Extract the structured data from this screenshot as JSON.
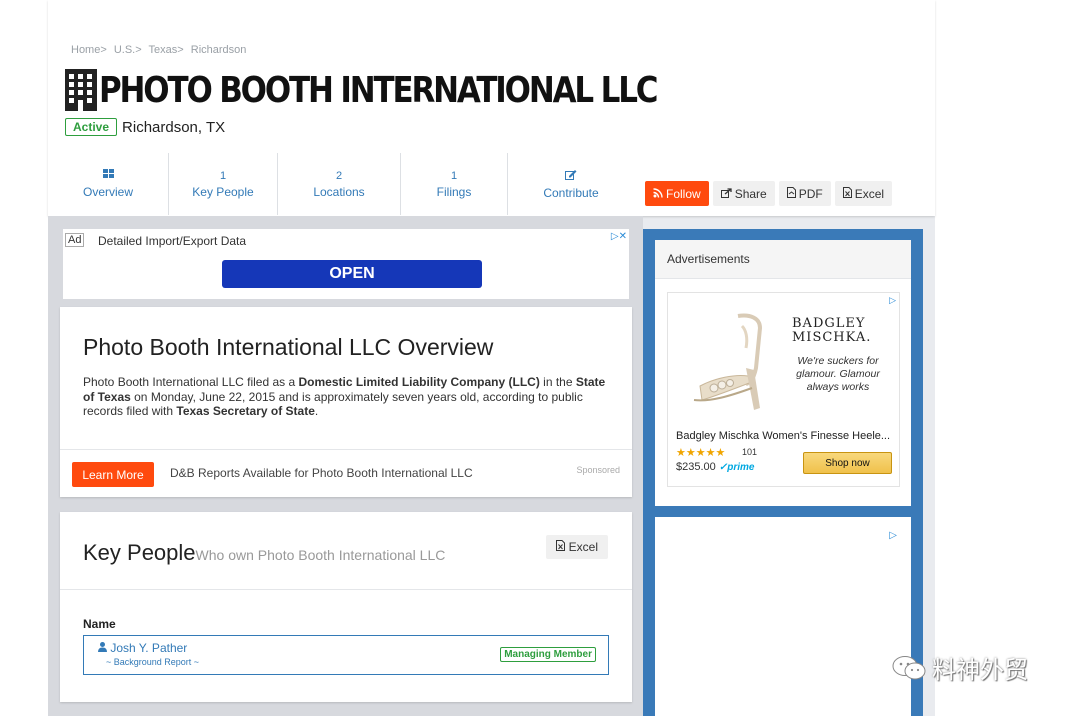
{
  "breadcrumb": [
    "Home>",
    "U.S.>",
    "Texas>",
    "Richardson"
  ],
  "company": {
    "name": "PHOTO BOOTH INTERNATIONAL LLC",
    "status": "Active",
    "location": "Richardson, TX"
  },
  "tabs": [
    {
      "icon": "th-large",
      "count": "",
      "label": "Overview"
    },
    {
      "icon": "",
      "count": "1",
      "label": "Key People"
    },
    {
      "icon": "",
      "count": "2",
      "label": "Locations"
    },
    {
      "icon": "",
      "count": "1",
      "label": "Filings"
    },
    {
      "icon": "edit",
      "count": "",
      "label": "Contribute"
    }
  ],
  "actions": {
    "follow": "Follow",
    "share": "Share",
    "pdf": "PDF",
    "excel": "Excel"
  },
  "top_ad": {
    "label": "Ad",
    "text": "Detailed Import/Export Data",
    "button": "OPEN"
  },
  "overview": {
    "title": "Photo Booth International LLC Overview",
    "text_1": "Photo Booth International LLC filed as a ",
    "entity_type": "Domestic Limited Liability Company (LLC)",
    "text_2": " in the ",
    "state": "State of Texas",
    "text_3": " on Monday, June 22, 2015 and is approximately seven years old, according to public records filed with ",
    "agency": "Texas Secretary of State",
    "text_4": ".",
    "learn_more": "Learn More",
    "dnb_text": "D&B Reports Available for Photo Booth International LLC",
    "sponsored": "Sponsored"
  },
  "key_people": {
    "title": "Key People",
    "subtitle": "Who own Photo Booth International LLC",
    "excel": "Excel",
    "name_header": "Name",
    "people": [
      {
        "name": "Josh Y. Pather",
        "report": "~ Background Report ~",
        "role": "Managing Member"
      }
    ]
  },
  "sidebar": {
    "ads_heading": "Advertisements",
    "brand_line_1": "BADGLEY",
    "brand_line_2": "MISCHKA.",
    "tagline": "We're suckers for glamour. Glamour always works",
    "product_name": "Badgley Mischka Women's Finesse Heele...",
    "stars": "★★★★★",
    "rating_count": "101",
    "price": "$235.00",
    "prime": "✓prime",
    "shop_button": "Shop now"
  },
  "watermark": "料神外贸",
  "colors": {
    "accent": "#ff4a0e",
    "link": "#337ab7",
    "active": "#2e9e3e",
    "sidebar": "#3a7ab8",
    "open_button": "#1537b8"
  }
}
